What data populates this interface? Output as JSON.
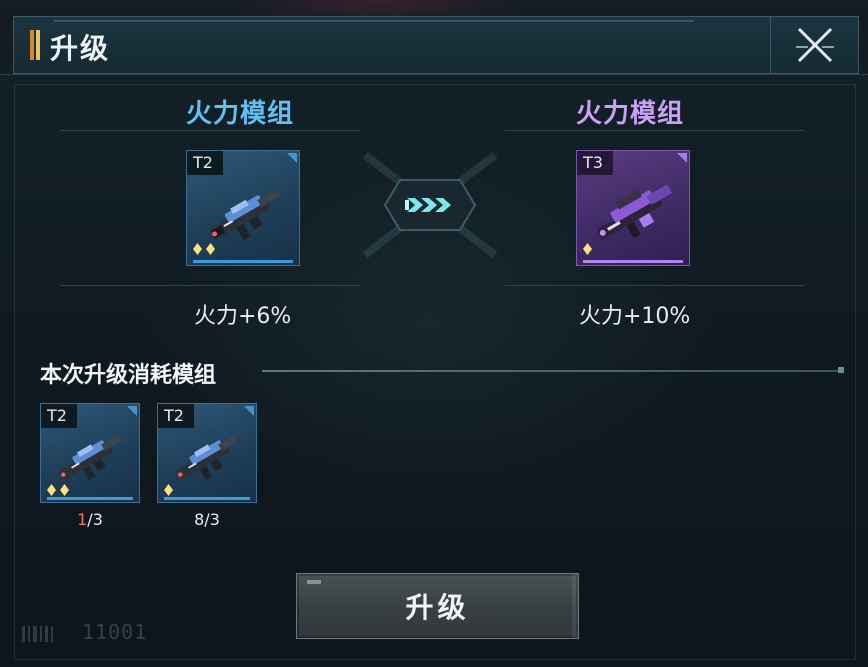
{
  "header": {
    "title": "升级",
    "close_icon": "close-icon"
  },
  "upgrade": {
    "current": {
      "name": "火力模组",
      "tier": "T2",
      "stars": 2,
      "stat": "火力+6%",
      "color": "#5fc0f5"
    },
    "next": {
      "name": "火力模组",
      "tier": "T3",
      "stars": 1,
      "stat": "火力+10%",
      "color": "#c9a0f4"
    },
    "arrow_icon": "triple-chevron-right-icon"
  },
  "consume": {
    "title": "本次升级消耗模组",
    "items": [
      {
        "tier": "T2",
        "stars": 2,
        "have": "1",
        "need": "/3"
      },
      {
        "tier": "T2",
        "stars": 1,
        "have": "8",
        "need": "/3"
      }
    ]
  },
  "button": {
    "label": "升级"
  },
  "watermark": "11001",
  "colors": {
    "accent_blue": "#3a9bd8",
    "accent_purple": "#b383f2",
    "warning_red": "#ff6a6a",
    "title_mark": "#f2c25a"
  }
}
